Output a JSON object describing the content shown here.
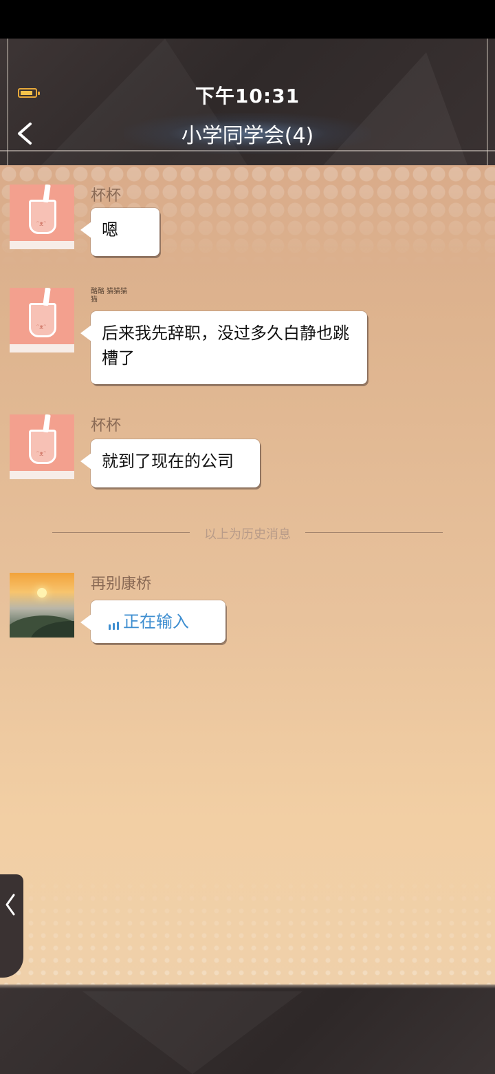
{
  "status_bar": {
    "time": "下午10:31",
    "battery_icon": "battery-icon"
  },
  "header": {
    "title": "小学同学会(4)",
    "back_icon": "back-arrow-icon"
  },
  "messages": [
    {
      "sender": "杯杯",
      "text": "嗯",
      "avatar": "cup-avatar"
    },
    {
      "sender": "酪酪 猫猫猫 猫",
      "text": "后来我先辞职，没过多久白静也跳槽了",
      "avatar": "cup-avatar"
    },
    {
      "sender": "杯杯",
      "text": "就到了现在的公司",
      "avatar": "cup-avatar"
    }
  ],
  "history_divider": "以上为历史消息",
  "typing_message": {
    "sender": "再别康桥",
    "text": "正在输入",
    "avatar": "sunset-avatar"
  },
  "side_tab": {
    "icon": "chevron-left-icon"
  },
  "colors": {
    "chat_bg": "#e8c29c",
    "typing_blue": "#3e8ed0",
    "header_bg": "#332c2c"
  }
}
